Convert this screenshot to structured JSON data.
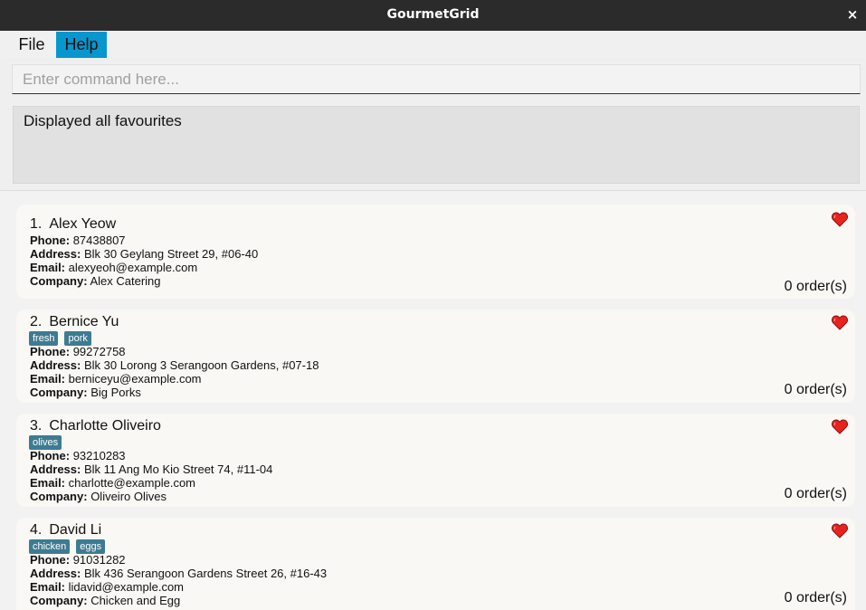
{
  "window": {
    "title": "GourmetGrid",
    "close_glyph": "×"
  },
  "menu": {
    "items": [
      {
        "label": "File"
      },
      {
        "label": "Help"
      }
    ]
  },
  "command": {
    "placeholder": "Enter command here...",
    "value": ""
  },
  "result": {
    "message": "Displayed all favourites"
  },
  "labels": {
    "phone": "Phone:",
    "address": "Address:",
    "email": "Email:",
    "company": "Company:"
  },
  "icons": {
    "favourite": "heart-icon",
    "close": "close-icon"
  },
  "colors": {
    "heart": "#e8231d",
    "tag": "#3e7b91",
    "help_highlight": "#0896cf"
  },
  "contacts": [
    {
      "index": "1.",
      "name": "Alex Yeow",
      "tags": [],
      "phone": "87438807",
      "address": "Blk 30 Geylang Street 29, #06-40",
      "email": "alexyeoh@example.com",
      "company": "Alex Catering",
      "orders": "0 order(s)"
    },
    {
      "index": "2.",
      "name": "Bernice Yu",
      "tags": [
        "fresh",
        "pork"
      ],
      "phone": "99272758",
      "address": "Blk 30 Lorong 3 Serangoon Gardens, #07-18",
      "email": "berniceyu@example.com",
      "company": "Big Porks",
      "orders": "0 order(s)"
    },
    {
      "index": "3.",
      "name": "Charlotte Oliveiro",
      "tags": [
        "olives"
      ],
      "phone": "93210283",
      "address": "Blk 11 Ang Mo Kio Street 74, #11-04",
      "email": "charlotte@example.com",
      "company": "Oliveiro Olives",
      "orders": "0 order(s)"
    },
    {
      "index": "4.",
      "name": "David Li",
      "tags": [
        "chicken",
        "eggs"
      ],
      "phone": "91031282",
      "address": "Blk 436 Serangoon Gardens Street 26, #16-43",
      "email": "lidavid@example.com",
      "company": "Chicken and Egg",
      "orders": "0 order(s)"
    }
  ]
}
